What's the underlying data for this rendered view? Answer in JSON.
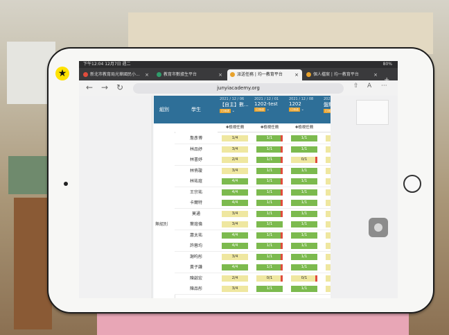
{
  "browser": {
    "status_time": "下午12:04 12月7日 週二",
    "status_battery": "80%",
    "tabs": [
      {
        "label": "新北市教育局光華國民小...",
        "icon_color": "#e04c3c",
        "active": false
      },
      {
        "label": "教育市數據生平台",
        "icon_color": "#2f9d6b",
        "active": false
      },
      {
        "label": "派送任務 | 均一教育平台",
        "icon_color": "#e8a22c",
        "active": true
      },
      {
        "label": "個人檔案 | 均一教育平台",
        "icon_color": "#e8a22c",
        "active": false
      }
    ],
    "url": "junyiacademy.org",
    "back_icon": "←",
    "forward_icon": "→",
    "reload_icon": "↻",
    "close_glyph": "×",
    "plus_glyph": "+",
    "share_icon": "⇧",
    "tabs_icon": "A",
    "more_icon": "···"
  },
  "table": {
    "group_header": "組別",
    "student_header": "學生",
    "sub_chevron": "⌄",
    "tasks": [
      {
        "date": "2021 / 12 / 06",
        "name": "【自主】數...",
        "badge": "已派送",
        "sub": "✚檢視任務"
      },
      {
        "date": "2021 / 12 / 01",
        "name": "1202-test",
        "badge": "已派送",
        "sub": "✚檢視任務"
      },
      {
        "date": "2021 / 12 / 08",
        "name": "1202",
        "badge": "已派送",
        "sub": "✚檢視任務"
      },
      {
        "date": "2021 / 1...",
        "name": "盤點幼",
        "badge": "已派送",
        "sub": "✚檢視"
      }
    ],
    "group_label": "無組別",
    "rows": [
      {
        "name": "詹彥博",
        "cells": [
          {
            "t": "1/4",
            "s": "y"
          },
          {
            "t": "1/1",
            "s": "g",
            "f": true
          },
          {
            "t": "1/1",
            "s": "g"
          },
          {
            "t": "3/",
            "s": "y"
          }
        ]
      },
      {
        "name": "林品妤",
        "cells": [
          {
            "t": "3/4",
            "s": "y"
          },
          {
            "t": "1/1",
            "s": "g",
            "f": true
          },
          {
            "t": "1/1",
            "s": "g"
          },
          {
            "t": "3/",
            "s": "y"
          }
        ]
      },
      {
        "name": "林書妤",
        "cells": [
          {
            "t": "2/4",
            "s": "y"
          },
          {
            "t": "1/1",
            "s": "g",
            "f": true
          },
          {
            "t": "0/1",
            "s": "y",
            "f": true
          },
          {
            "t": "3/",
            "s": "y"
          }
        ]
      },
      {
        "name": "林侑璇",
        "cells": [
          {
            "t": "3/4",
            "s": "y"
          },
          {
            "t": "1/1",
            "s": "g",
            "f": true
          },
          {
            "t": "1/1",
            "s": "g"
          },
          {
            "t": "1/",
            "s": "y"
          }
        ]
      },
      {
        "name": "林祐瑄",
        "cells": [
          {
            "t": "4/4",
            "s": "g"
          },
          {
            "t": "1/1",
            "s": "g",
            "f": true
          },
          {
            "t": "1/1",
            "s": "g"
          },
          {
            "t": "0/",
            "s": "y"
          }
        ]
      },
      {
        "name": "王宗祐",
        "cells": [
          {
            "t": "4/4",
            "s": "g"
          },
          {
            "t": "1/1",
            "s": "g",
            "f": true
          },
          {
            "t": "1/1",
            "s": "g"
          },
          {
            "t": "3/",
            "s": "y"
          }
        ]
      },
      {
        "name": "卡爾特",
        "cells": [
          {
            "t": "4/4",
            "s": "g"
          },
          {
            "t": "1/1",
            "s": "g",
            "f": true
          },
          {
            "t": "1/1",
            "s": "g"
          },
          {
            "t": "3/",
            "s": "y"
          }
        ]
      },
      {
        "name": "莫通",
        "cells": [
          {
            "t": "3/4",
            "s": "y"
          },
          {
            "t": "1/1",
            "s": "g",
            "f": true
          },
          {
            "t": "1/1",
            "s": "g"
          },
          {
            "t": "3/",
            "s": "y"
          }
        ]
      },
      {
        "name": "葉瑄倫",
        "cells": [
          {
            "t": "3/4",
            "s": "y"
          },
          {
            "t": "1/1",
            "s": "g"
          },
          {
            "t": "1/1",
            "s": "g"
          },
          {
            "t": "3/",
            "s": "y"
          }
        ]
      },
      {
        "name": "蕭太祐",
        "cells": [
          {
            "t": "4/4",
            "s": "g"
          },
          {
            "t": "1/1",
            "s": "g",
            "f": true
          },
          {
            "t": "1/1",
            "s": "g"
          },
          {
            "t": "3/",
            "s": "y"
          }
        ]
      },
      {
        "name": "許蓉均",
        "cells": [
          {
            "t": "4/4",
            "s": "g"
          },
          {
            "t": "1/1",
            "s": "g",
            "f": true
          },
          {
            "t": "1/1",
            "s": "g"
          },
          {
            "t": "3/",
            "s": "y"
          }
        ]
      },
      {
        "name": "謝昀彤",
        "cells": [
          {
            "t": "3/4",
            "s": "y"
          },
          {
            "t": "1/1",
            "s": "g",
            "f": true
          },
          {
            "t": "1/1",
            "s": "g"
          },
          {
            "t": "3/",
            "s": "y"
          }
        ]
      },
      {
        "name": "黃子謙",
        "cells": [
          {
            "t": "4/4",
            "s": "g"
          },
          {
            "t": "1/1",
            "s": "g",
            "f": true
          },
          {
            "t": "1/1",
            "s": "g"
          },
          {
            "t": "3/",
            "s": "y"
          }
        ]
      },
      {
        "name": "陳啟宏",
        "cells": [
          {
            "t": "2/4",
            "s": "y"
          },
          {
            "t": "0/1",
            "s": "y",
            "f": true
          },
          {
            "t": "0/1",
            "s": "y",
            "f": true
          },
          {
            "t": "3/",
            "s": "y"
          }
        ]
      },
      {
        "name": "陳品彤",
        "cells": [
          {
            "t": "3/4",
            "s": "y"
          },
          {
            "t": "1/1",
            "s": "g"
          },
          {
            "t": "1/1",
            "s": "g"
          },
          {
            "t": "3/",
            "s": "y"
          }
        ]
      }
    ]
  },
  "colors": {
    "header_blue": "#2e6f98",
    "done_green": "#7cba4e",
    "partial_yellow": "#efe7a0",
    "flag_red": "#e04c3c"
  }
}
